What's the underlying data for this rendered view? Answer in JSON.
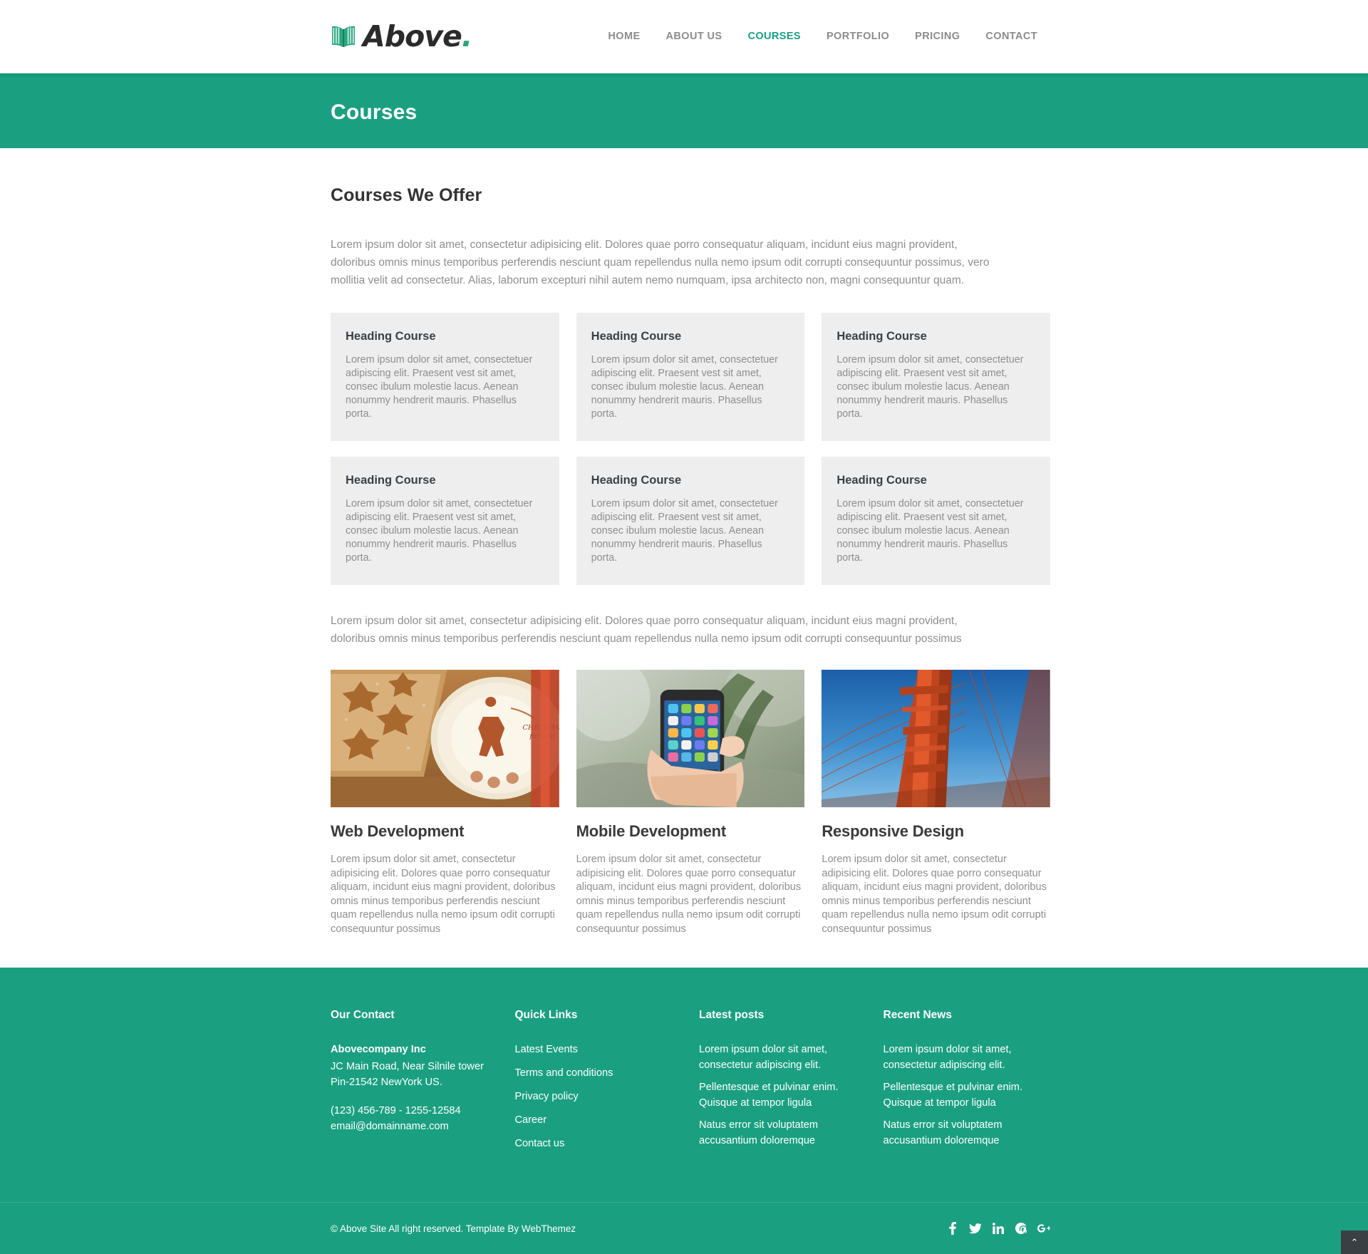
{
  "brand": {
    "name": "Above",
    "dot": ".",
    "icon": "open-book-icon"
  },
  "nav": {
    "items": [
      {
        "label": "HOME",
        "active": false
      },
      {
        "label": "ABOUT US",
        "active": false
      },
      {
        "label": "COURSES",
        "active": true
      },
      {
        "label": "PORTFOLIO",
        "active": false
      },
      {
        "label": "PRICING",
        "active": false
      },
      {
        "label": "CONTACT",
        "active": false
      }
    ]
  },
  "banner": {
    "title": "Courses"
  },
  "main": {
    "section_title": "Courses We Offer",
    "lead": "Lorem ipsum dolor sit amet, consectetur adipisicing elit. Dolores quae porro consequatur aliquam, incidunt eius magni provident, doloribus omnis minus temporibus perferendis nesciunt quam repellendus nulla nemo ipsum odit corrupti consequuntur possimus, vero mollitia velit ad consectetur. Alias, laborum excepturi nihil autem nemo numquam, ipsa architecto non, magni consequuntur quam.",
    "lead2": "Lorem ipsum dolor sit amet, consectetur adipisicing elit. Dolores quae porro consequatur aliquam, incidunt eius magni provident, doloribus omnis minus temporibus perferendis nesciunt quam repellendus nulla nemo ipsum odit corrupti consequuntur possimus",
    "cards": [
      {
        "title": "Heading Course",
        "text": "Lorem ipsum dolor sit amet, consectetuer adipiscing elit. Praesent vest sit amet, consec ibulum molestie lacus. Aenean nonummy hendrerit mauris. Phasellus porta."
      },
      {
        "title": "Heading Course",
        "text": "Lorem ipsum dolor sit amet, consectetuer adipiscing elit. Praesent vest sit amet, consec ibulum molestie lacus. Aenean nonummy hendrerit mauris. Phasellus porta."
      },
      {
        "title": "Heading Course",
        "text": "Lorem ipsum dolor sit amet, consectetuer adipiscing elit. Praesent vest sit amet, consec ibulum molestie lacus. Aenean nonummy hendrerit mauris. Phasellus porta."
      },
      {
        "title": "Heading Course",
        "text": "Lorem ipsum dolor sit amet, consectetuer adipiscing elit. Praesent vest sit amet, consec ibulum molestie lacus. Aenean nonummy hendrerit mauris. Phasellus porta."
      },
      {
        "title": "Heading Course",
        "text": "Lorem ipsum dolor sit amet, consectetuer adipiscing elit. Praesent vest sit amet, consec ibulum molestie lacus. Aenean nonummy hendrerit mauris. Phasellus porta."
      },
      {
        "title": "Heading Course",
        "text": "Lorem ipsum dolor sit amet, consectetuer adipiscing elit. Praesent vest sit amet, consec ibulum molestie lacus. Aenean nonummy hendrerit mauris. Phasellus porta."
      }
    ],
    "services": [
      {
        "title": "Web Development",
        "image": "gingerbread-cookies-photo",
        "text": "Lorem ipsum dolor sit amet, consectetur adipisicing elit. Dolores quae porro consequatur aliquam, incidunt eius magni provident, doloribus omnis minus temporibus perferendis nesciunt quam repellendus nulla nemo ipsum odit corrupti consequuntur possimus"
      },
      {
        "title": "Mobile Development",
        "image": "hand-holding-smartphone-photo",
        "text": "Lorem ipsum dolor sit amet, consectetur adipisicing elit. Dolores quae porro consequatur aliquam, incidunt eius magni provident, doloribus omnis minus temporibus perferendis nesciunt quam repellendus nulla nemo ipsum odit corrupti consequuntur possimus"
      },
      {
        "title": "Responsive Design",
        "image": "golden-gate-bridge-photo",
        "text": "Lorem ipsum dolor sit amet, consectetur adipisicing elit. Dolores quae porro consequatur aliquam, incidunt eius magni provident, doloribus omnis minus temporibus perferendis nesciunt quam repellendus nulla nemo ipsum odit corrupti consequuntur possimus"
      }
    ]
  },
  "footer": {
    "contact": {
      "heading": "Our Contact",
      "company": "Abovecompany Inc",
      "address1": "JC Main Road, Near Silnile tower",
      "address2": "Pin-21542 NewYork US.",
      "phone": "(123) 456-789 - 1255-12584",
      "email": "email@domainname.com"
    },
    "quick_links": {
      "heading": "Quick Links",
      "items": [
        "Latest Events",
        "Terms and conditions",
        "Privacy policy",
        "Career",
        "Contact us"
      ]
    },
    "latest_posts": {
      "heading": "Latest posts",
      "items": [
        "Lorem ipsum dolor sit amet, consectetur adipiscing elit.",
        "Pellentesque et pulvinar enim. Quisque at tempor ligula",
        "Natus error sit voluptatem accusantium doloremque"
      ]
    },
    "recent_news": {
      "heading": "Recent News",
      "items": [
        "Lorem ipsum dolor sit amet, consectetur adipiscing elit.",
        "Pellentesque et pulvinar enim. Quisque at tempor ligula",
        "Natus error sit voluptatem accusantium doloremque"
      ]
    },
    "copyright": "© Above Site All right reserved. Template By WebThemez",
    "socials": [
      "facebook-icon",
      "twitter-icon",
      "linkedin-icon",
      "pinterest-icon",
      "google-plus-icon"
    ],
    "scroll_top_label": "⌃"
  },
  "colors": {
    "brand_green": "#1aa080",
    "accent": "#16a085",
    "card_bg": "#eeeeee",
    "muted_text": "#8e8e8e"
  }
}
